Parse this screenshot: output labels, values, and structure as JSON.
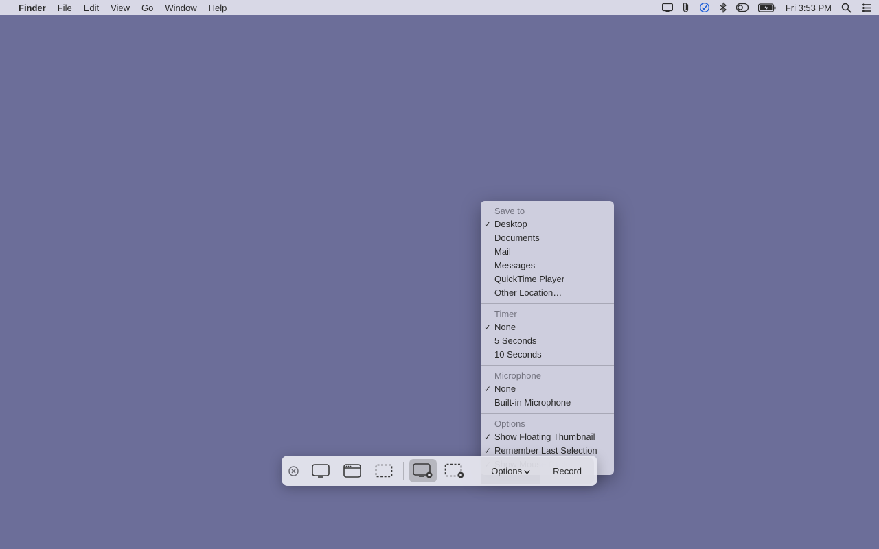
{
  "menubar": {
    "app_name": "Finder",
    "menus": [
      "File",
      "Edit",
      "View",
      "Go",
      "Window",
      "Help"
    ],
    "clock": "Fri 3:53 PM"
  },
  "toolbar": {
    "options_label": "Options",
    "record_label": "Record",
    "selected_mode": "record_entire"
  },
  "options_menu": {
    "sections": [
      {
        "label": "Save to",
        "items": [
          {
            "text": "Desktop",
            "checked": true
          },
          {
            "text": "Documents",
            "checked": false
          },
          {
            "text": "Mail",
            "checked": false
          },
          {
            "text": "Messages",
            "checked": false
          },
          {
            "text": "QuickTime Player",
            "checked": false
          },
          {
            "text": "Other Location…",
            "checked": false
          }
        ]
      },
      {
        "label": "Timer",
        "items": [
          {
            "text": "None",
            "checked": true
          },
          {
            "text": "5 Seconds",
            "checked": false
          },
          {
            "text": "10 Seconds",
            "checked": false
          }
        ]
      },
      {
        "label": "Microphone",
        "items": [
          {
            "text": "None",
            "checked": true
          },
          {
            "text": "Built-in Microphone",
            "checked": false
          }
        ]
      },
      {
        "label": "Options",
        "items": [
          {
            "text": "Show Floating Thumbnail",
            "checked": true
          },
          {
            "text": "Remember Last Selection",
            "checked": true
          },
          {
            "text": "Show Mouse Clicks",
            "checked": true
          }
        ]
      }
    ]
  }
}
